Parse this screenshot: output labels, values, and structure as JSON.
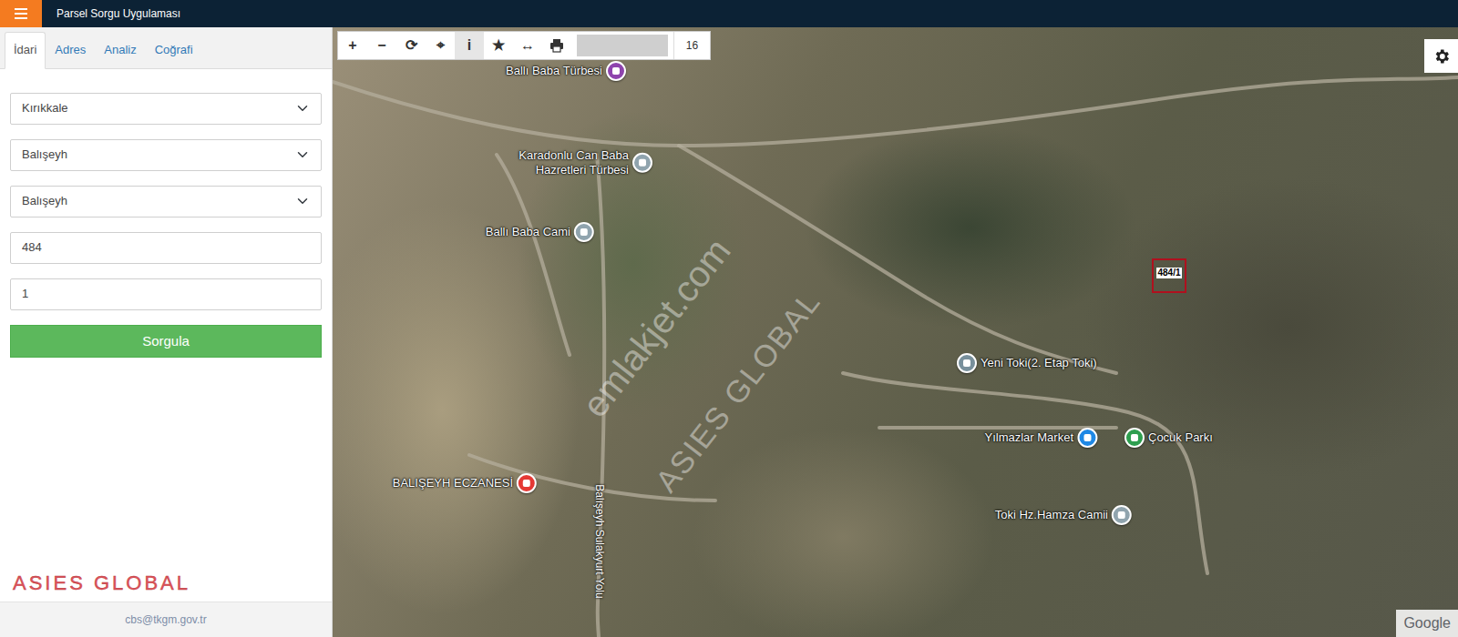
{
  "app": {
    "title": "Parsel Sorgu Uygulaması"
  },
  "tabs": [
    {
      "label": "İdari",
      "selected": true
    },
    {
      "label": "Adres",
      "selected": false
    },
    {
      "label": "Analiz",
      "selected": false
    },
    {
      "label": "Coğrafi",
      "selected": false
    }
  ],
  "form": {
    "il": "Kırıkkale",
    "ilce": "Balışeyh",
    "mahalle": "Balışeyh",
    "ada": "484",
    "parsel": "1",
    "submit": "Sorgula"
  },
  "logo": "ASIES GLOBAL",
  "footer": "cbs@tkgm.gov.tr",
  "map": {
    "toolbar": {
      "buttons": [
        "+",
        "−",
        "⟳",
        "⌖",
        "i",
        "★",
        "↔"
      ],
      "zoom": "16"
    },
    "pins": [
      {
        "label": "Ballı Baba Türbesi",
        "color": "#8e44ad"
      },
      {
        "label": "Karadonlu Can Baba Hazretleri Türbesi",
        "color": "#90a4ae"
      },
      {
        "label": "Ballı Baba Cami",
        "color": "#90a4ae"
      },
      {
        "label": "Yeni Toki(2. Etap Toki)",
        "color": "#78909c"
      },
      {
        "label": "Yılmazlar Market",
        "color": "#1e88e5"
      },
      {
        "label": "Çocuk Parkı",
        "color": "#2e9e4f"
      },
      {
        "label": "Toki Hz.Hamza Camii",
        "color": "#90a4ae"
      },
      {
        "label": "BALIŞEYH ECZANESİ",
        "color": "#e53935"
      }
    ],
    "road_label": "Balışeyh Sulakyurt Yolu",
    "parcel": "484/1",
    "watermarks": [
      "emlakjet.com",
      "ASIES GLOBAL"
    ],
    "attribution": "Google"
  }
}
